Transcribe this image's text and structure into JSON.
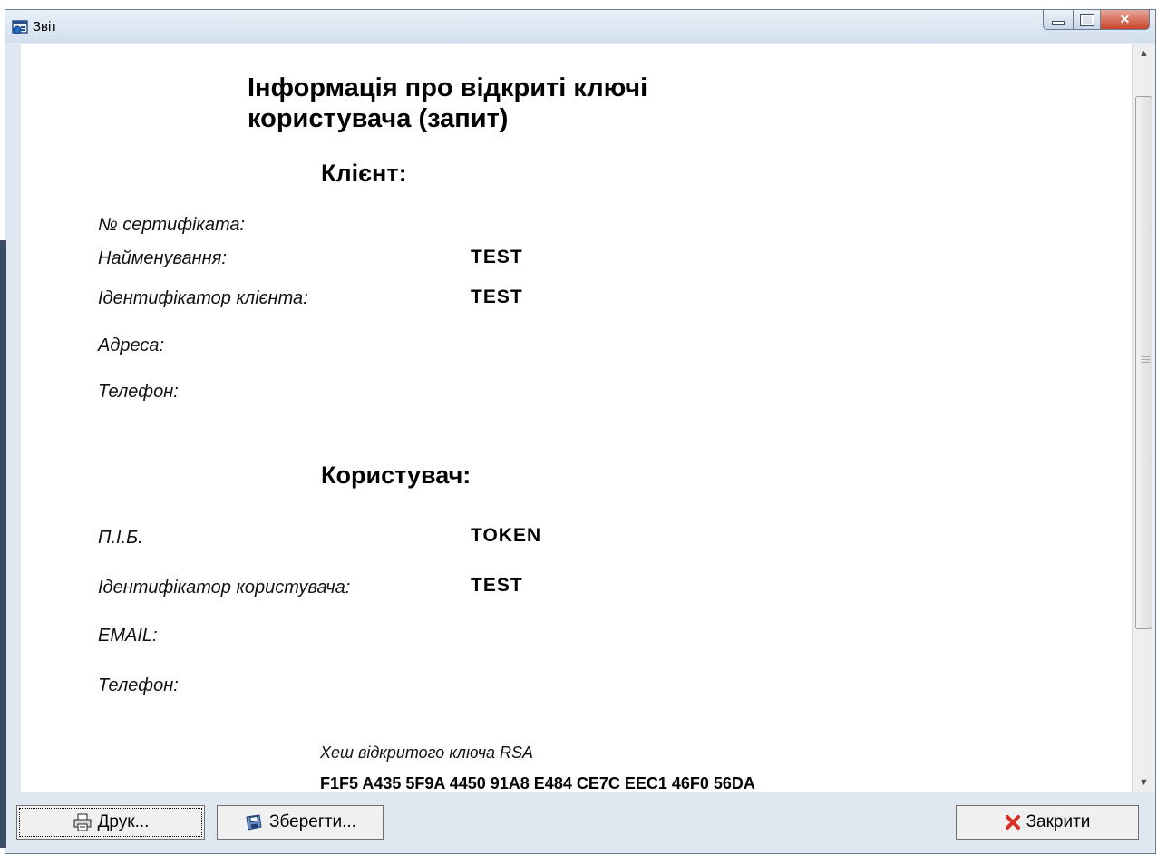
{
  "window": {
    "title": "Звіт"
  },
  "report": {
    "title_line1": "Інформація про відкриті ключі",
    "title_line2": "користувача (запит)",
    "client_heading": "Клієнт:",
    "client_fields": [
      {
        "label": "№ сертифіката:",
        "value": ""
      },
      {
        "label": "Найменування:",
        "value": "TEST"
      },
      {
        "label": "Ідентифікатор клієнта:",
        "value": "TEST"
      },
      {
        "label": "Адреса:",
        "value": ""
      },
      {
        "label": "Телефон:",
        "value": ""
      }
    ],
    "user_heading": "Користувач:",
    "user_fields": [
      {
        "label": "П.І.Б.",
        "value": "TOKEN"
      },
      {
        "label": "Ідентифікатор користувача:",
        "value": "TEST"
      },
      {
        "label": "EMAIL:",
        "value": ""
      },
      {
        "label": "Телефон:",
        "value": ""
      }
    ],
    "hash_label": "Хеш відкритого ключа RSA",
    "hash_value": "F1F5 A435 5F9A 4450 91A8 E484 CE7C EEC1 46F0 56DA"
  },
  "buttons": {
    "print_label": "Друк...",
    "save_label": "Зберегти...",
    "close_label": "Закрити"
  },
  "colors": {
    "close_icon": "#d93025",
    "chrome": "#dfe7f1"
  }
}
